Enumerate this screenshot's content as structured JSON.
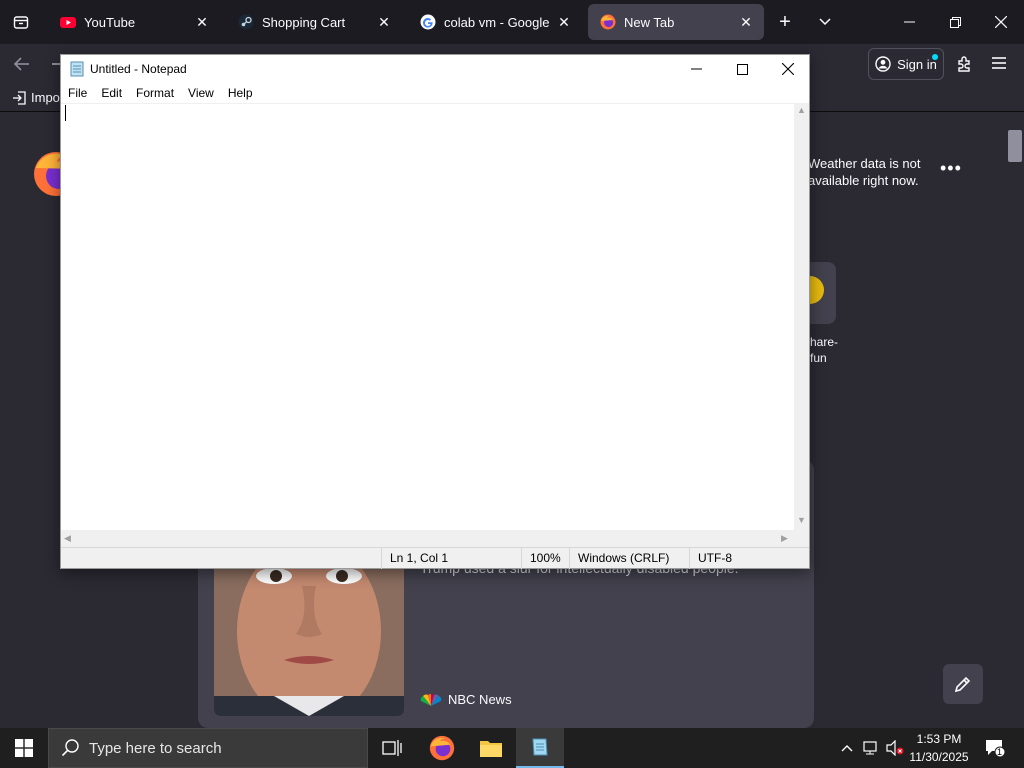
{
  "browser": {
    "tabs": [
      {
        "title": "YouTube",
        "icon": "youtube-icon",
        "active": false
      },
      {
        "title": "Shopping Cart",
        "icon": "steam-icon",
        "active": false
      },
      {
        "title": "colab vm - Google Search",
        "icon": "google-icon",
        "active": false
      },
      {
        "title": "New Tab",
        "icon": "firefox-icon",
        "active": true
      }
    ],
    "signin_label": "Sign in",
    "bookmark_import": "Impo",
    "weather_text_1": "Weather data is not",
    "weather_text_2": "available right now.",
    "shortcut_label_1": "hare-",
    "shortcut_label_2": "fun",
    "story_headline": "Trump used a slur for intellectually disabled people.",
    "story_source": "NBC News"
  },
  "notepad": {
    "title": "Untitled - Notepad",
    "menu": [
      "File",
      "Edit",
      "Format",
      "View",
      "Help"
    ],
    "status": {
      "position": "Ln 1, Col 1",
      "zoom": "100%",
      "line_endings": "Windows (CRLF)",
      "encoding": "UTF-8"
    }
  },
  "taskbar": {
    "search_placeholder": "Type here to search",
    "time": "1:53 PM",
    "date": "11/30/2025",
    "notification_count": "1"
  },
  "colors": {
    "firefox_dark": "#1c1b22",
    "firefox_toolbar": "#2b2a33",
    "active_tab": "#42414d",
    "taskbar": "#1f1f1f",
    "accent": "#76b9ed"
  }
}
